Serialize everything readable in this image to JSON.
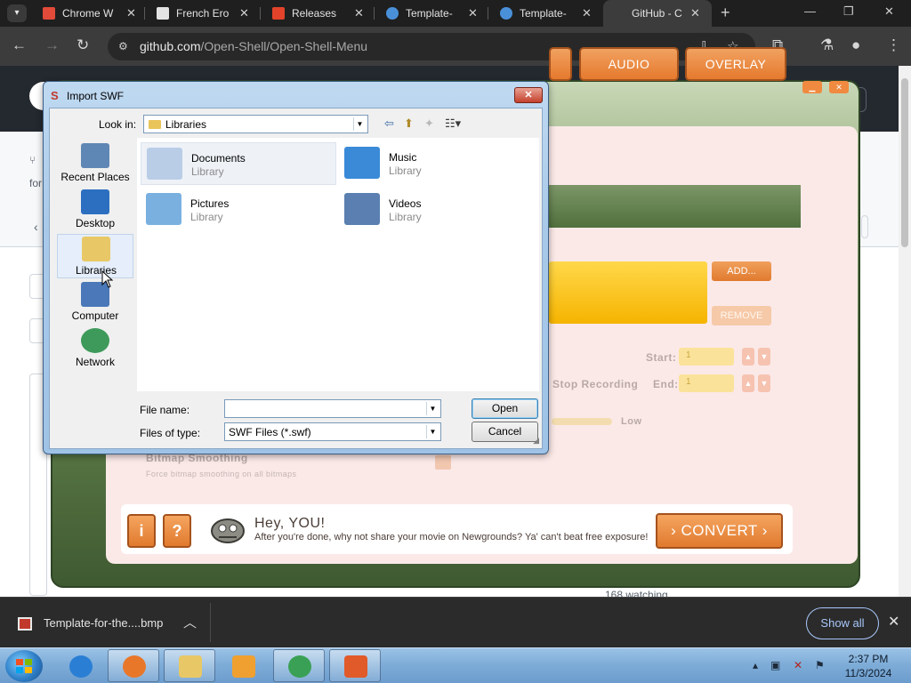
{
  "browser": {
    "tabs": [
      {
        "title": "Chrome W",
        "favicon": "chrome-web-store-icon",
        "color": "#e24a3a"
      },
      {
        "title": "French Ero",
        "favicon": "museum-icon",
        "color": "#e3e3e3"
      },
      {
        "title": "Releases",
        "favicon": "gitlab-icon",
        "color": "#e2432a"
      },
      {
        "title": "Template-",
        "favicon": "circle-logo-icon",
        "color": "#4a90d9"
      },
      {
        "title": "Template-",
        "favicon": "circle-logo-icon",
        "color": "#4a90d9"
      },
      {
        "title": "GitHub - C",
        "favicon": "github-icon",
        "color": "#e3e3e3",
        "active": true
      }
    ],
    "url_host": "github.com",
    "url_path": "/Open-Shell/Open-Shell-Menu"
  },
  "github": {
    "line1": "for",
    "watching": "168 watching"
  },
  "flash_app": {
    "tabs": [
      "AUDIO",
      "OVERLAY"
    ],
    "add_label": "ADD...",
    "remove_label": "REMOVE",
    "start_label": "Start:",
    "end_label": "End:",
    "start_value": "1",
    "end_value": "1",
    "stop_recording_label": "Stop Recording",
    "low_label": "Low",
    "bitmap_smoothing_title": "Bitmap Smoothing",
    "bitmap_smoothing_desc": "Force bitmap smoothing on all bitmaps",
    "help_buttons": [
      "i",
      "?"
    ],
    "hey_title": "Hey, YOU!",
    "hey_message": "After you're done, why not share your movie on Newgrounds?  Ya' can't beat free exposure!",
    "convert_label": "› CONVERT ›"
  },
  "dialog": {
    "title": "Import SWF",
    "look_in_label": "Look in:",
    "look_in_value": "Libraries",
    "places": [
      {
        "label": "Recent Places",
        "icon": "recent-places-icon",
        "color": "#5f87b5"
      },
      {
        "label": "Desktop",
        "icon": "desktop-icon",
        "color": "#2c6fc0"
      },
      {
        "label": "Libraries",
        "icon": "libraries-icon",
        "color": "#e8c866",
        "selected": true
      },
      {
        "label": "Computer",
        "icon": "computer-icon",
        "color": "#4a78b8"
      },
      {
        "label": "Network",
        "icon": "network-icon",
        "color": "#3e9a5a"
      }
    ],
    "items": [
      {
        "name": "Documents",
        "type": "Library",
        "icon": "documents-library-icon",
        "color": "#b9cde6"
      },
      {
        "name": "Music",
        "type": "Library",
        "icon": "music-library-icon",
        "color": "#3a8ad8"
      },
      {
        "name": "Pictures",
        "type": "Library",
        "icon": "pictures-library-icon",
        "color": "#7ab0e0"
      },
      {
        "name": "Videos",
        "type": "Library",
        "icon": "videos-library-icon",
        "color": "#5a7fb0"
      }
    ],
    "file_name_label": "File name:",
    "file_name_value": "",
    "file_type_label": "Files of type:",
    "file_type_value": "SWF Files (*.swf)",
    "open_label": "Open",
    "cancel_label": "Cancel"
  },
  "downloads": {
    "file_name": "Template-for-the....bmp",
    "show_all": "Show all"
  },
  "taskbar": {
    "apps": [
      {
        "name": "internet-explorer",
        "color": "#2a7fd4",
        "running": false
      },
      {
        "name": "firefox",
        "color": "#e8772a",
        "running": true
      },
      {
        "name": "file-explorer",
        "color": "#e8c866",
        "running": true
      },
      {
        "name": "media-player",
        "color": "#f0a030",
        "running": false
      },
      {
        "name": "chrome",
        "color": "#3aa055",
        "running": true
      },
      {
        "name": "swf-converter",
        "color": "#e05a2a",
        "running": true
      }
    ],
    "time": "2:37 PM",
    "date": "11/3/2024"
  }
}
